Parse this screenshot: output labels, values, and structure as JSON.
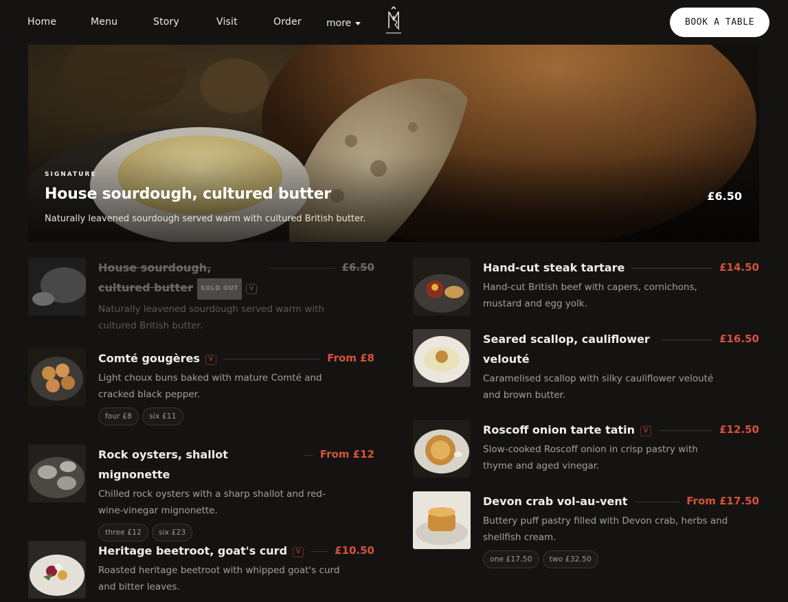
{
  "nav": {
    "links": [
      "Home",
      "Menu",
      "Story",
      "Visit",
      "Order"
    ],
    "more_label": "more",
    "cta_label": "BOOK A TABLE",
    "logo_text": "MAISON REGAL"
  },
  "hero": {
    "badge": "SIGNATURE",
    "title": "House sourdough, cultured butter",
    "description": "Naturally leavened sourdough served warm with cultured British butter.",
    "price": "£6.50"
  },
  "menu": {
    "left": [
      {
        "name": "House sourdough, cultured butter",
        "price": "£6.50",
        "soldout_label": "SOLD OUT",
        "tag": "V",
        "description": "Naturally leavened sourdough served warm with cultured British butter."
      },
      {
        "name": "Comté gougères",
        "tag": "V",
        "price": "From £8",
        "description": "Light choux buns baked with mature Comté and cracked black pepper.",
        "options": [
          "four  £8",
          "six  £11"
        ]
      },
      {
        "name": "Rock oysters, shallot mignonette",
        "price": "From £12",
        "description": "Chilled rock oysters with a sharp shallot and red-wine-vinegar mignonette.",
        "options": [
          "three  £12",
          "six  £23"
        ]
      },
      {
        "name": "Heritage beetroot, goat's curd",
        "tag": "V",
        "price": "£10.50",
        "description": "Roasted heritage beetroot with whipped goat's curd and bitter leaves."
      }
    ],
    "right": [
      {
        "name": "Hand-cut steak tartare",
        "price": "£14.50",
        "description": "Hand-cut British beef with capers, cornichons, mustard and egg yolk."
      },
      {
        "name": "Seared scallop, cauliflower velouté",
        "price": "£16.50",
        "description": "Caramelised scallop with silky cauliflower velouté and brown butter."
      },
      {
        "name": "Roscoff onion tarte tatin",
        "tag": "V",
        "price": "£12.50",
        "description": "Slow-cooked Roscoff onion in crisp pastry with thyme and aged vinegar."
      },
      {
        "name": "Devon crab vol-au-vent",
        "price": "From £17.50",
        "description": "Buttery puff pastry filled with Devon crab, herbs and shellfish cream.",
        "options": [
          "one  £17.50",
          "two  £32.50"
        ]
      }
    ]
  },
  "colors": {
    "background": "#141312",
    "accent": "#d8523a",
    "text": "#f4efe6",
    "muted": "#a7a099"
  }
}
